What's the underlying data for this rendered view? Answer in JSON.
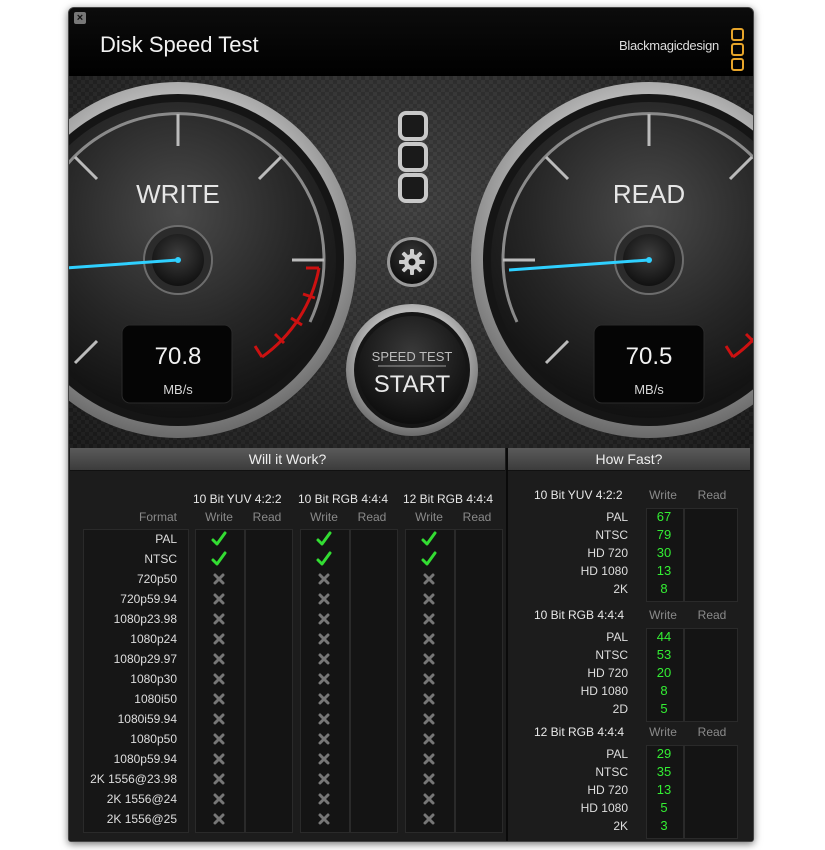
{
  "window": {
    "title": "Disk Speed Test",
    "brand": "Blackmagicdesign",
    "close_icon": "close-icon"
  },
  "gauges": {
    "write": {
      "label": "WRITE",
      "value": "70.8",
      "unit": "MB/s"
    },
    "read": {
      "label": "READ",
      "value": "70.5",
      "unit": "MB/s"
    }
  },
  "controls": {
    "settings_icon": "gear-icon",
    "start_top": "SPEED TEST",
    "start_main": "START"
  },
  "will_it_work": {
    "title": "Will it Work?",
    "format_header": "Format",
    "write_label": "Write",
    "read_label": "Read",
    "groups": [
      "10 Bit YUV 4:2:2",
      "10 Bit RGB 4:4:4",
      "12 Bit RGB 4:4:4"
    ],
    "formats": [
      "PAL",
      "NTSC",
      "720p50",
      "720p59.94",
      "1080p23.98",
      "1080p24",
      "1080p29.97",
      "1080p30",
      "1080i50",
      "1080i59.94",
      "1080p50",
      "1080p59.94",
      "2K 1556@23.98",
      "2K 1556@24",
      "2K 1556@25"
    ],
    "write_ok": [
      [
        true,
        true,
        false,
        false,
        false,
        false,
        false,
        false,
        false,
        false,
        false,
        false,
        false,
        false,
        false
      ],
      [
        true,
        true,
        false,
        false,
        false,
        false,
        false,
        false,
        false,
        false,
        false,
        false,
        false,
        false,
        false
      ],
      [
        true,
        true,
        false,
        false,
        false,
        false,
        false,
        false,
        false,
        false,
        false,
        false,
        false,
        false,
        false
      ]
    ],
    "colors": {
      "ok": "#33dd33",
      "fail": "#777777"
    }
  },
  "how_fast": {
    "title": "How Fast?",
    "write_label": "Write",
    "read_label": "Read",
    "groups": [
      {
        "name": "10 Bit YUV 4:2:2",
        "rows": [
          {
            "format": "PAL",
            "write": "67"
          },
          {
            "format": "NTSC",
            "write": "79"
          },
          {
            "format": "HD 720",
            "write": "30"
          },
          {
            "format": "HD 1080",
            "write": "13"
          },
          {
            "format": "2K",
            "write": "8"
          }
        ]
      },
      {
        "name": "10 Bit RGB 4:4:4",
        "rows": [
          {
            "format": "PAL",
            "write": "44"
          },
          {
            "format": "NTSC",
            "write": "53"
          },
          {
            "format": "HD 720",
            "write": "20"
          },
          {
            "format": "HD 1080",
            "write": "8"
          },
          {
            "format": "2D",
            "write": "5"
          }
        ]
      },
      {
        "name": "12 Bit RGB 4:4:4",
        "rows": [
          {
            "format": "PAL",
            "write": "29"
          },
          {
            "format": "NTSC",
            "write": "35"
          },
          {
            "format": "HD 720",
            "write": "13"
          },
          {
            "format": "HD 1080",
            "write": "5"
          },
          {
            "format": "2K",
            "write": "3"
          }
        ]
      }
    ]
  },
  "colors": {
    "accent_needle": "#2fd0ff",
    "redline": "#cc1111",
    "value_green": "#33ee33"
  }
}
